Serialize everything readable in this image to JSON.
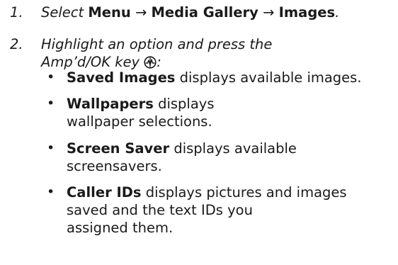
{
  "steps": [
    {
      "number": "1.",
      "select_word": "Select",
      "path": [
        "Menu",
        "Media Gallery",
        "Images"
      ],
      "arrow": "→",
      "end_punct": "."
    },
    {
      "number": "2.",
      "line1": "Highlight an option and press the",
      "line2": "Amp’d/OK key",
      "end_punct": ":",
      "key_icon": "ampd-ok-key-icon"
    }
  ],
  "options": [
    {
      "name": "Saved Images",
      "desc": "displays available images."
    },
    {
      "name": "Wallpapers",
      "desc_line1": "displays",
      "desc_line2": "wallpaper selections."
    },
    {
      "name": "Screen Saver",
      "desc_line1": "displays available",
      "desc_line2": "screensavers."
    },
    {
      "name": "Caller IDs",
      "desc_line1": "displays pictures and images",
      "desc_line2": "saved and the text IDs you",
      "desc_line3": "assigned them."
    }
  ],
  "bullet": "•"
}
